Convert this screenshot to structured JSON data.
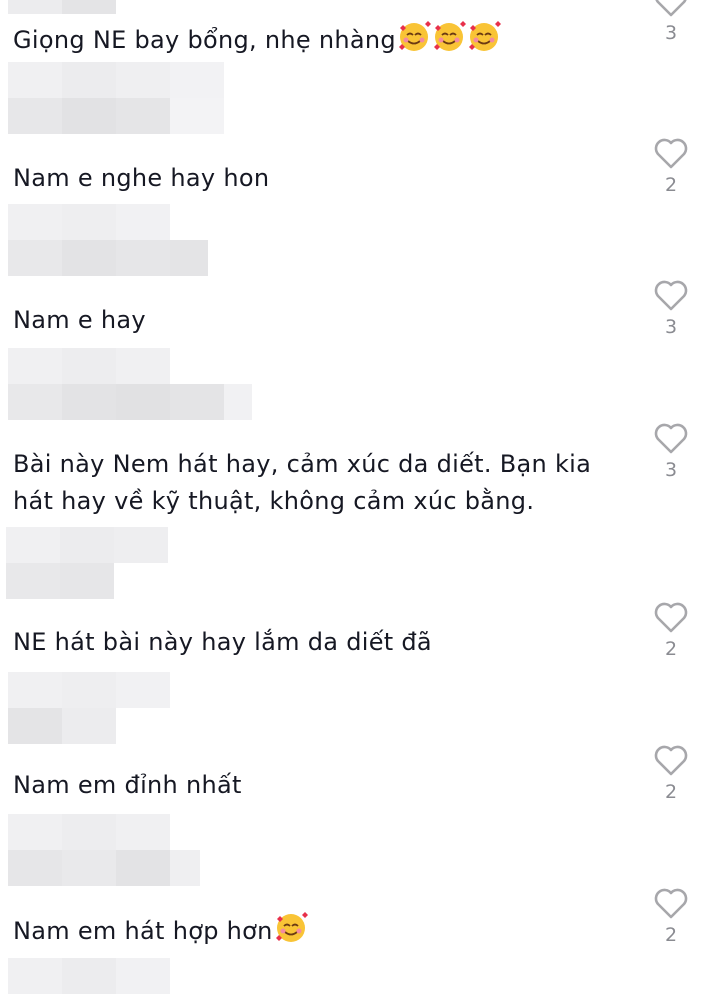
{
  "comments": [
    {
      "text": "Giọng NE bay bổng, nhẹ nhàng",
      "emoji_count": 3,
      "likes": "3"
    },
    {
      "text": "Nam e nghe hay hon",
      "emoji_count": 0,
      "likes": "2"
    },
    {
      "text": "Nam e hay",
      "emoji_count": 0,
      "likes": "3"
    },
    {
      "text_lines": [
        "Bài này Nem hát hay, cảm xúc da diết. Bạn kia",
        "hát hay về kỹ thuật, không cảm xúc bằng."
      ],
      "emoji_count": 0,
      "likes": "3"
    },
    {
      "text": "NE hát bài này hay lắm da diết đã",
      "emoji_count": 0,
      "likes": "2"
    },
    {
      "text": "Nam em đỉnh nhất",
      "emoji_count": 0,
      "likes": "2"
    },
    {
      "text": "Nam em hát hợp hơn",
      "emoji_count": 1,
      "likes": "2"
    }
  ],
  "icons": {
    "like": "heart-outline-icon",
    "emoji": "smiling-face-with-hearts-icon"
  },
  "colors": {
    "text": "#161823",
    "count": "#8a8b91",
    "heart": "#a7a7ab",
    "blur": "#e6e6e8"
  }
}
